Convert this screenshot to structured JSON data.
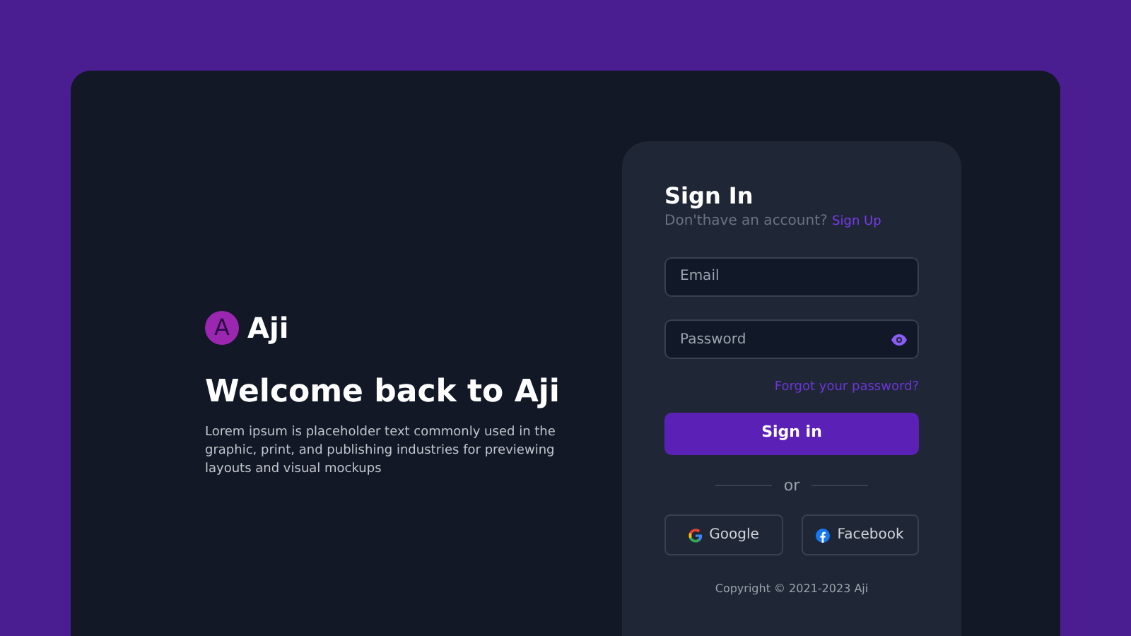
{
  "brand": {
    "mark": "A",
    "name": "Aji"
  },
  "hero": {
    "title": "Welcome back to Aji",
    "text": "Lorem ipsum is placeholder text commonly used in the graphic, print, and publishing industries for previewing layouts and visual mockups"
  },
  "form": {
    "title": "Sign In",
    "prompt": "Don'thave an account?",
    "signup_link": "Sign Up",
    "fields": [
      {
        "kind": "text",
        "placeholder": "Email"
      },
      {
        "kind": "password",
        "placeholder": "Password"
      }
    ],
    "forgot_link": "Forgot your password?",
    "submit": "Sign in",
    "divider": "or",
    "social": [
      {
        "kind": "google",
        "label": "Google"
      },
      {
        "kind": "facebook",
        "label": "Facebook"
      }
    ],
    "copyright": "Copyright © 2021-2023 Aji"
  }
}
